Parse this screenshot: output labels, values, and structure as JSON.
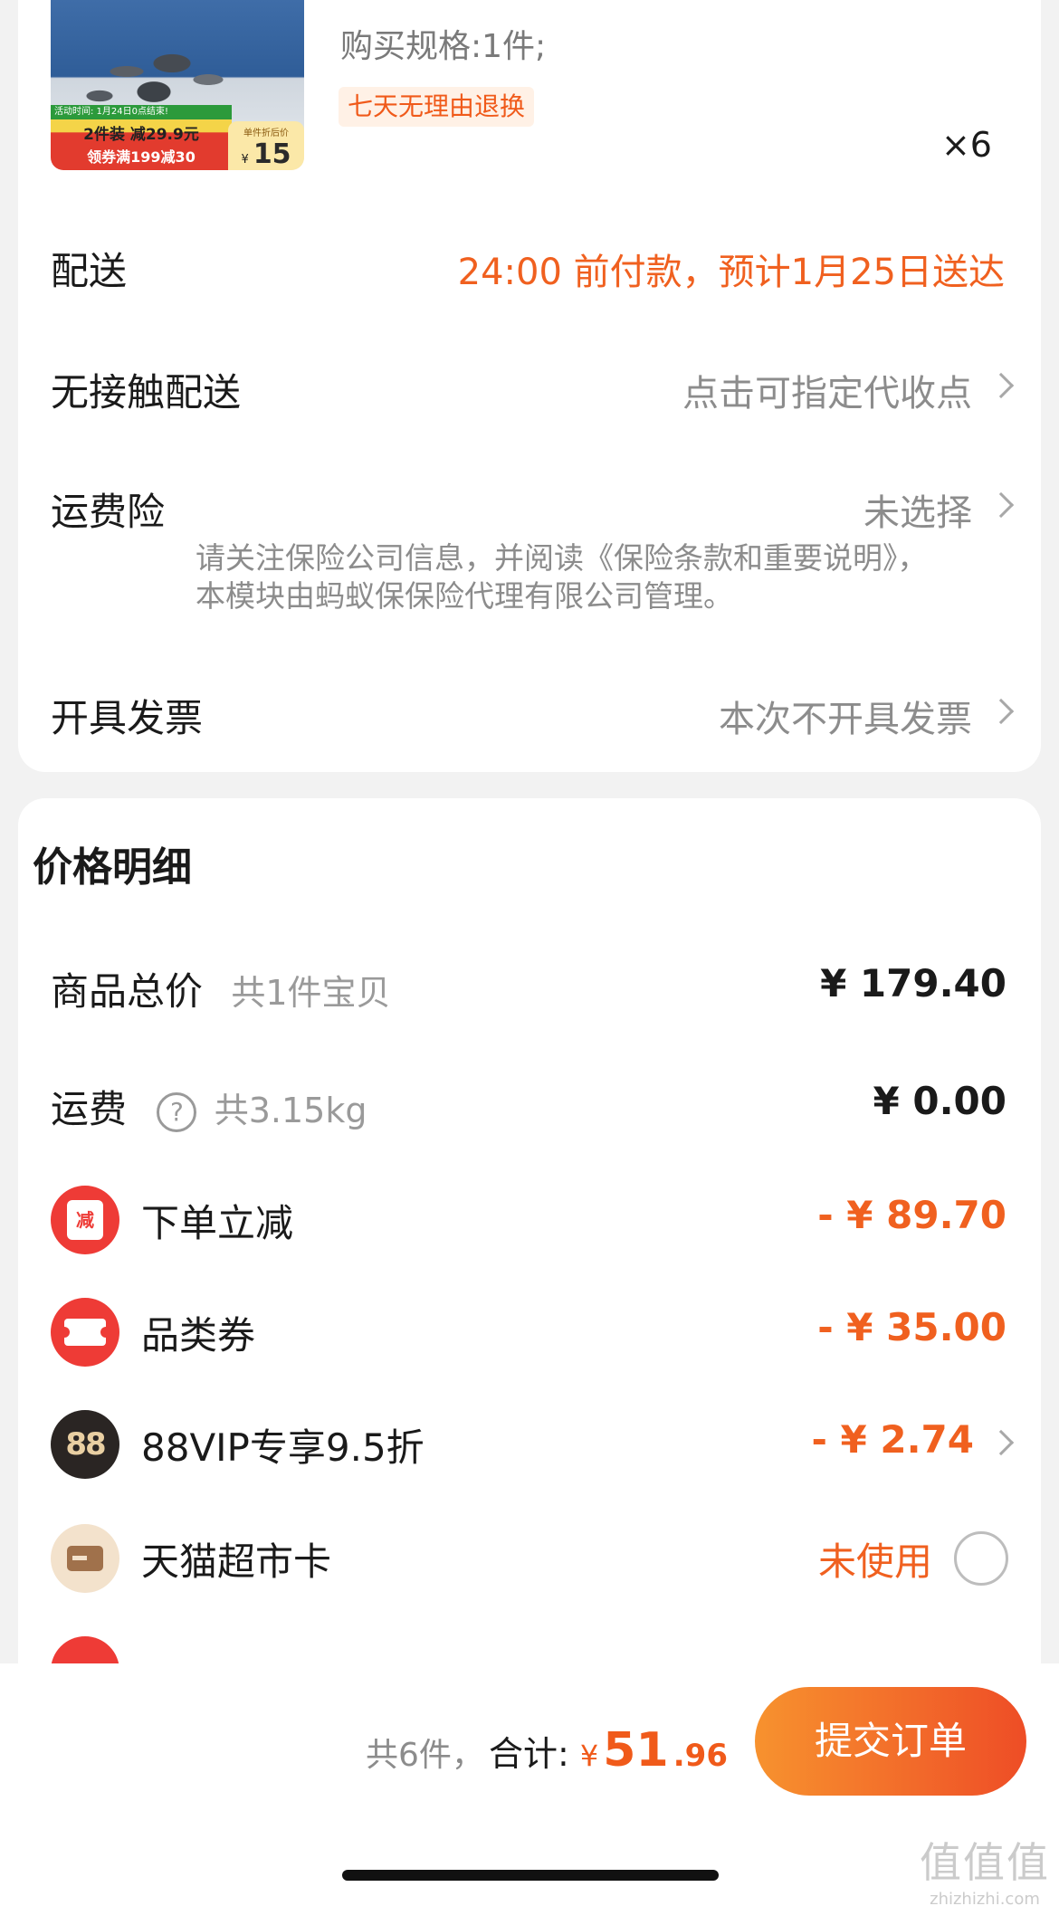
{
  "product": {
    "spec": "购买规格:1件;",
    "tag": "七天无理由退换",
    "quantity": "×6",
    "thumbnail": {
      "activity_text": "活动时间: 1月24日0点结束!",
      "promo_main": "2件装 减29.9元",
      "promo_coupon": "领券满199减30",
      "unit_price_label": "单件折后价",
      "currency": "¥",
      "unit_price": "15"
    }
  },
  "order_options": {
    "delivery": {
      "label": "配送",
      "value": "24:00 前付款，预计1月25日送达"
    },
    "contactless": {
      "label": "无接触配送",
      "value": "点击可指定代收点"
    },
    "shipping_insurance": {
      "label": "运费险",
      "value": "未选择",
      "note": "请关注保险公司信息，并阅读《保险条款和重要说明》，本模块由蚂蚁保保险代理有限公司管理。"
    },
    "invoice": {
      "label": "开具发票",
      "value": "本次不开具发票"
    }
  },
  "price_detail": {
    "title": "价格明细",
    "goods_total": {
      "label": "商品总价",
      "sub": "共1件宝贝",
      "value": "¥ 179.40"
    },
    "shipping": {
      "label": "运费",
      "sub": "共3.15kg",
      "value": "¥ 0.00",
      "help_icon": "?"
    },
    "discounts": [
      {
        "label": "下单立减",
        "value": "- ¥ 89.70",
        "icon": "reduce-icon",
        "icon_text": "减",
        "has_chevron": false
      },
      {
        "label": "品类券",
        "value": "- ¥ 35.00",
        "icon": "ticket-icon",
        "has_chevron": false
      },
      {
        "label": "88VIP专享9.5折",
        "value": "- ¥ 2.74",
        "icon": "vip88-icon",
        "icon_text": "88",
        "has_chevron": true
      },
      {
        "label": "天猫超市卡",
        "value": "未使用",
        "icon": "card-icon",
        "has_radio": true
      }
    ]
  },
  "footer": {
    "count_text": "共6件，",
    "total_label": "合计: ",
    "currency": "¥",
    "total_int": "51",
    "total_dec": ".96",
    "submit_label": "提交订单",
    "watermark_main": "值值值",
    "watermark_sub": "zhizhizhi.com"
  },
  "colors": {
    "accent": "#f0601f",
    "submit_gradient_start": "#f7922e",
    "submit_gradient_end": "#ee4d26",
    "red_icon": "#ee3b36"
  }
}
